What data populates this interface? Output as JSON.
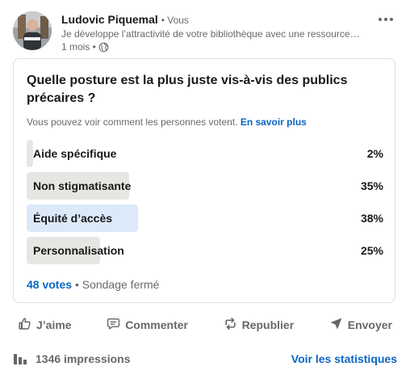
{
  "post": {
    "author_name": "Ludovic Piquemal",
    "author_relation": "• Vous",
    "tagline": "Je développe l’attractivité de votre bibliothèque avec une ressource …",
    "time": "1 mois •",
    "visibility_icon": "globe-icon",
    "more_icon": "more-options-icon"
  },
  "poll": {
    "question": "Quelle posture est la plus juste vis-à-vis des publics précaires ?",
    "visibility_text": "Vous pouvez voir comment les personnes votent.",
    "learn_more": "En savoir plus",
    "options": [
      {
        "label": "Aide spécifique",
        "percent": "2%",
        "share": 0.02,
        "selected": false
      },
      {
        "label": "Non stigmatisante",
        "percent": "35%",
        "share": 0.35,
        "selected": false
      },
      {
        "label": "Équité d’accès",
        "percent": "38%",
        "share": 0.38,
        "selected": true
      },
      {
        "label": "Personnalisation",
        "percent": "25%",
        "share": 0.25,
        "selected": false
      }
    ],
    "votes": "48 votes",
    "status": "• Sondage fermé"
  },
  "actions": {
    "like": "J’aime",
    "comment": "Commenter",
    "repost": "Republier",
    "send": "Envoyer"
  },
  "stats": {
    "impressions": "1346 impressions",
    "view_stats": "Voir les statistiques"
  },
  "colors": {
    "accent": "#0a66c2",
    "bar": "#e8e6e3",
    "bar_selected": "#dce9f8"
  }
}
